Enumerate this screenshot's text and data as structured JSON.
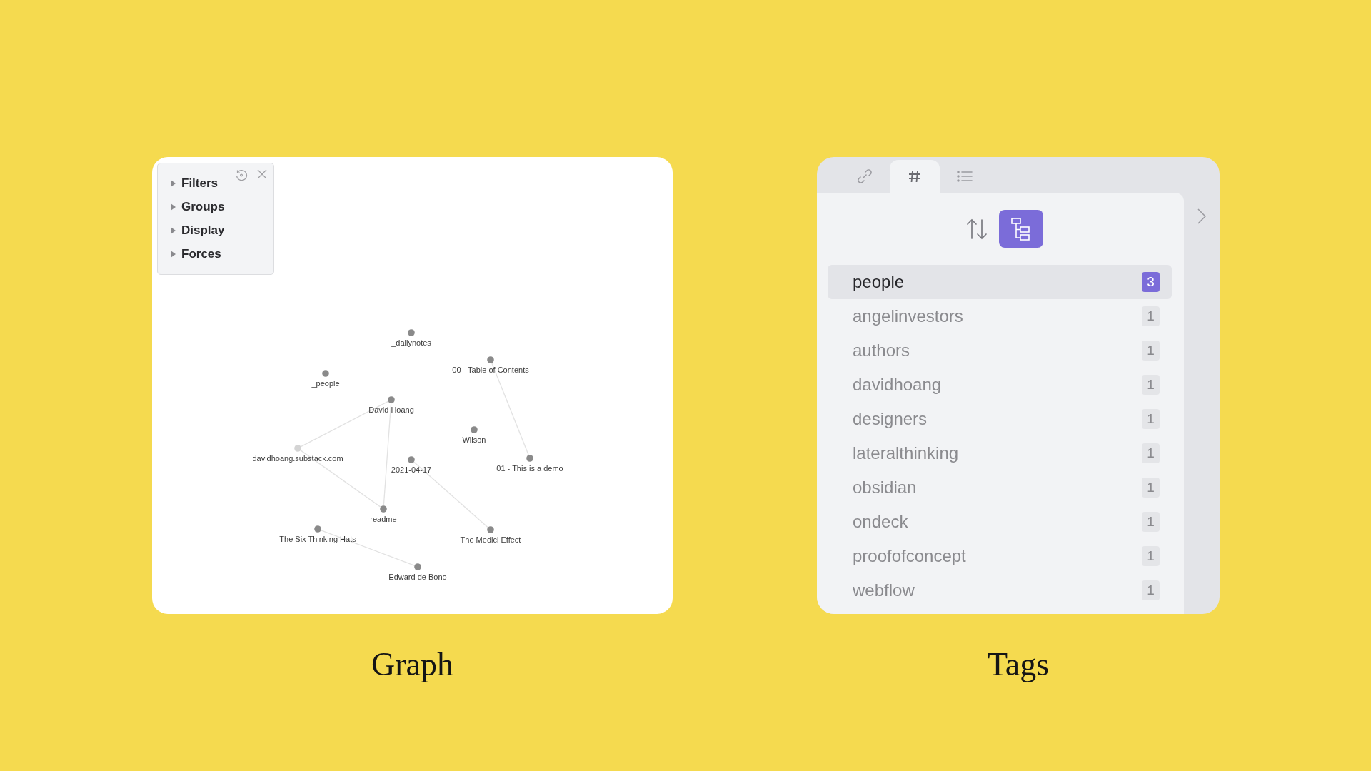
{
  "graph_view": {
    "controls": [
      {
        "label": "Filters",
        "expanded": false
      },
      {
        "label": "Groups",
        "expanded": false
      },
      {
        "label": "Display",
        "expanded": false
      },
      {
        "label": "Forces",
        "expanded": false
      }
    ],
    "nodes": [
      {
        "label": "_dailynotes",
        "kind": "note"
      },
      {
        "label": "00 - Table of Contents",
        "kind": "note"
      },
      {
        "label": "_people",
        "kind": "note"
      },
      {
        "label": "David Hoang",
        "kind": "note"
      },
      {
        "label": "Wilson",
        "kind": "note"
      },
      {
        "label": "davidhoang.substack.com",
        "kind": "unresolved"
      },
      {
        "label": "2021-04-17",
        "kind": "note"
      },
      {
        "label": "01 - This is a demo",
        "kind": "note"
      },
      {
        "label": "readme",
        "kind": "note"
      },
      {
        "label": "The Six Thinking Hats",
        "kind": "note"
      },
      {
        "label": "The Medici Effect",
        "kind": "note"
      },
      {
        "label": "Edward de Bono",
        "kind": "note"
      }
    ],
    "caption": "Graph"
  },
  "tags_view": {
    "tabs": [
      {
        "kind": "links",
        "selected": false
      },
      {
        "kind": "tags",
        "selected": true
      },
      {
        "kind": "outline",
        "selected": false
      }
    ],
    "tree_view_on": true,
    "tags": [
      {
        "name": "people",
        "count": "3",
        "selected": true
      },
      {
        "name": "angelinvestors",
        "count": "1",
        "selected": false
      },
      {
        "name": "authors",
        "count": "1",
        "selected": false
      },
      {
        "name": "davidhoang",
        "count": "1",
        "selected": false
      },
      {
        "name": "designers",
        "count": "1",
        "selected": false
      },
      {
        "name": "lateralthinking",
        "count": "1",
        "selected": false
      },
      {
        "name": "obsidian",
        "count": "1",
        "selected": false
      },
      {
        "name": "ondeck",
        "count": "1",
        "selected": false
      },
      {
        "name": "proofofconcept",
        "count": "1",
        "selected": false
      },
      {
        "name": "webflow",
        "count": "1",
        "selected": false
      }
    ],
    "caption": "Tags"
  }
}
